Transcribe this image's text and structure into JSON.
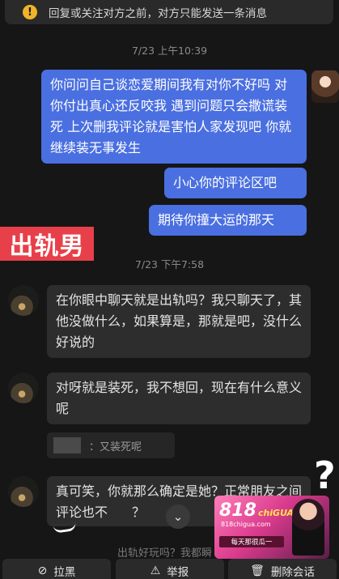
{
  "notice": {
    "icon": "warning-icon",
    "text": "回复或关注对方之前，对方只能发送一条消息"
  },
  "timestamps": [
    "7/23 上午10:39",
    "7/23 下午7:58"
  ],
  "messages_sent": [
    "你问问自己谈恋爱期间我有对你不好吗 对你付出真心还反咬我 遇到问题只会撒谎装死 上次删我评论就是害怕人家发现吧 你就继续装无事发生",
    "小心你的评论区吧",
    "期待你撞大运的那天"
  ],
  "overlay_tag": "出轨男",
  "messages_received": [
    "在你眼中聊天就是出轨吗？我只聊天了，其他没做什么，如果算是，那就是吧，没什么好说的",
    "对呀就是装死，我不想回，现在有什么意义呢",
    "真可笑，你就那么确定是她？正常朋友之间评论也不",
    "？"
  ],
  "quote": {
    "text": "：又装死呢"
  },
  "cutoff_text": "出轨好玩吗？我都瞬",
  "overlay_question": "?",
  "ad": {
    "brand": "818",
    "brand_sub": "chiGUA",
    "site": "818chigua.com",
    "slogan": "每天那很瓜一"
  },
  "actions": [
    {
      "icon": "block-icon",
      "label": "拉黑"
    },
    {
      "icon": "warning-icon",
      "label": "举报"
    },
    {
      "icon": "trash-icon",
      "label": "删除会话"
    }
  ],
  "colors": {
    "sent_bubble": "#4a6fe0",
    "received_bubble": "#2d2d2d",
    "tag": "#e8404a",
    "background": "#161616"
  }
}
